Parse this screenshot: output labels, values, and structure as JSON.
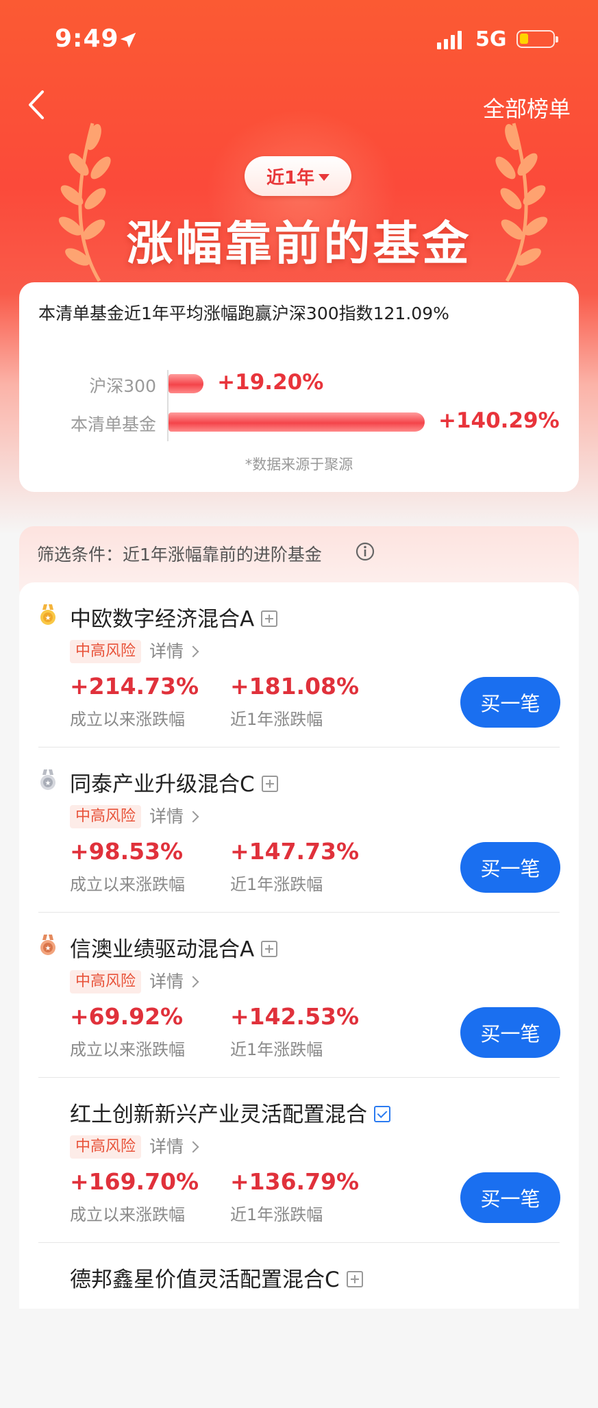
{
  "status_bar": {
    "time": "9:49",
    "network": "5G"
  },
  "header": {
    "all_list": "全部榜单",
    "period": "近1年",
    "title": "涨幅靠前的基金"
  },
  "summary": {
    "text": "本清单基金近1年平均涨幅跑赢沪深300指数121.09%",
    "bars": [
      {
        "label": "沪深300",
        "value": "+19.20%",
        "pct": 19.2
      },
      {
        "label": "本清单基金",
        "value": "+140.29%",
        "pct": 140.29
      }
    ],
    "source": "*数据来源于聚源"
  },
  "filter": {
    "text": "筛选条件：近1年涨幅靠前的进阶基金"
  },
  "funds": [
    {
      "name": "中欧数字经济混合A",
      "medal": "gold",
      "risk": "中高风险",
      "detail": "详情",
      "since_inception": "+214.73%",
      "since_label": "成立以来涨跌幅",
      "one_year": "+181.08%",
      "year_label": "近1年涨跌幅",
      "buy": "买一笔"
    },
    {
      "name": "同泰产业升级混合C",
      "medal": "silver",
      "risk": "中高风险",
      "detail": "详情",
      "since_inception": "+98.53%",
      "since_label": "成立以来涨跌幅",
      "one_year": "+147.73%",
      "year_label": "近1年涨跌幅",
      "buy": "买一笔"
    },
    {
      "name": "信澳业绩驱动混合A",
      "medal": "bronze",
      "risk": "中高风险",
      "detail": "详情",
      "since_inception": "+69.92%",
      "since_label": "成立以来涨跌幅",
      "one_year": "+142.53%",
      "year_label": "近1年涨跌幅",
      "buy": "买一笔"
    },
    {
      "name": "红土创新新兴产业灵活配置混合",
      "medal": "",
      "risk": "中高风险",
      "detail": "详情",
      "since_inception": "+169.70%",
      "since_label": "成立以来涨跌幅",
      "one_year": "+136.79%",
      "year_label": "近1年涨跌幅",
      "buy": "买一笔"
    },
    {
      "name": "德邦鑫星价值灵活配置混合C",
      "medal": ""
    }
  ],
  "colors": {
    "accent": "#1a6ff0",
    "up": "#e0313b",
    "hero": "#fb4a3a"
  }
}
